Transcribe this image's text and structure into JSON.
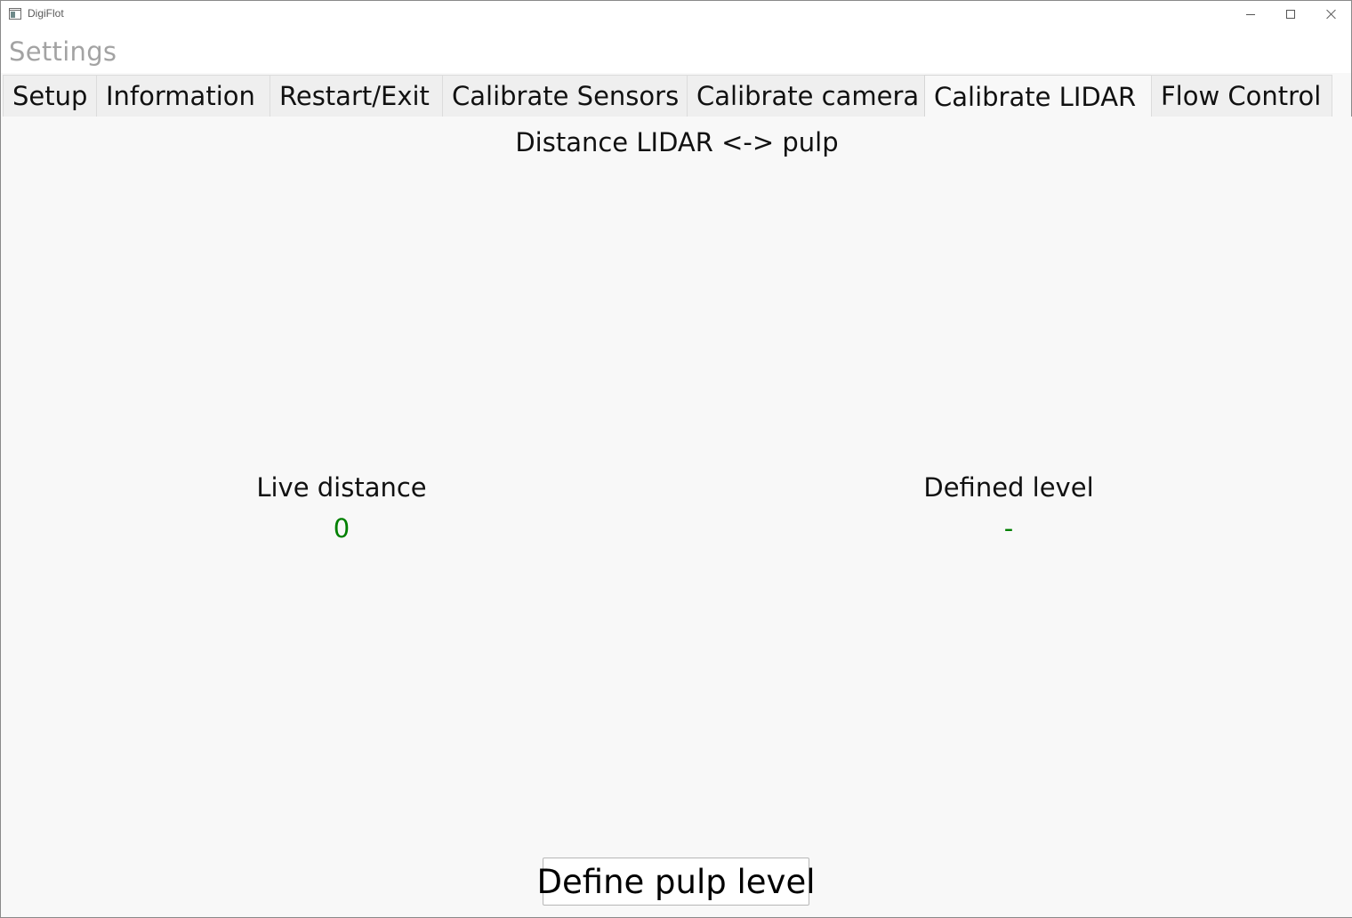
{
  "window": {
    "title": "DigiFlot"
  },
  "header": {
    "title": "Settings"
  },
  "tabs": [
    {
      "label": "Setup"
    },
    {
      "label": "Information"
    },
    {
      "label": "Restart/Exit"
    },
    {
      "label": "Calibrate Sensors"
    },
    {
      "label": "Calibrate camera"
    },
    {
      "label": "Calibrate LIDAR",
      "active": true
    },
    {
      "label": "Flow Control"
    }
  ],
  "lidar": {
    "section_title": "Distance LIDAR <-> pulp",
    "live_distance_label": "Live distance",
    "live_distance_value": "0",
    "defined_level_label": "Defined level",
    "defined_level_value": "-",
    "define_button_label": "Define pulp level",
    "value_color": "#008000"
  }
}
